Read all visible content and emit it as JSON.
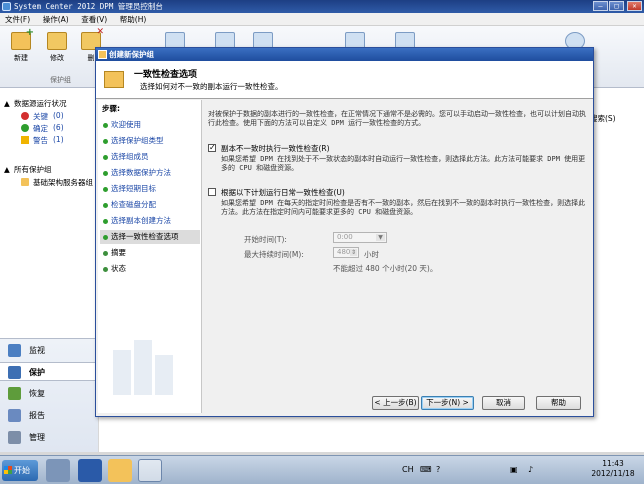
{
  "window": {
    "title": "System Center 2012 DPM 管理员控制台"
  },
  "menu": [
    "文件(F)",
    "操作(A)",
    "查看(V)",
    "帮助(H)"
  ],
  "ribbon": {
    "buttons": [
      {
        "label": "新建",
        "icon": "new-protection-group-icon"
      },
      {
        "label": "修改",
        "icon": "modify-icon"
      },
      {
        "label": "删",
        "icon": "delete-icon"
      }
    ],
    "group_label": "保护组"
  },
  "left_pane": {
    "status_header": "数据源运行状况",
    "status_items": [
      {
        "label": "关键",
        "count": "(0)",
        "color": "#d32f2f"
      },
      {
        "label": "确定",
        "count": "(6)",
        "color": "#2e9e2e"
      },
      {
        "label": "警告",
        "count": "(1)",
        "color": "#f0b400"
      }
    ],
    "groups_header": "所有保护组",
    "group_item": "基础架构服务器组"
  },
  "nav_bottom": [
    {
      "label": "监视",
      "icon": "monitor-icon"
    },
    {
      "label": "保护",
      "icon": "protection-icon",
      "selected": true
    },
    {
      "label": "恢复",
      "icon": "recovery-icon"
    },
    {
      "label": "报告",
      "icon": "report-icon"
    },
    {
      "label": "管理",
      "icon": "management-icon"
    }
  ],
  "right_pane": {
    "search_hint": "搜索(S)"
  },
  "dialog": {
    "title": "创建新保护组",
    "header_title": "一致性检查选项",
    "header_subtitle": "选择如何对不一致的副本运行一致性检查。",
    "steps_header": "步骤:",
    "steps": [
      "欢迎使用",
      "选择保护组类型",
      "选择组成员",
      "选择数据保护方法",
      "选择短期目标",
      "检查磁盘分配",
      "选择副本创建方法",
      "选择一致性检查选项",
      "摘要",
      "状态"
    ],
    "intro": "对被保护于数据的副本进行的一致性检查，在正常情况下通常不是必需的。您可以手动启动一致性检查，也可以计划自动执行此检查。使用下面的方法可以自定义 DPM 运行一致性检查的方式。",
    "option1": {
      "label": "副本不一致时执行一致性检查(R)",
      "checked": true,
      "desc": "如果您希望 DPM 在找到处于不一致状态的副本时自动运行一致性检查，则选择此方法。此方法可能要求 DPM 使用更多的 CPU 和磁盘资源。"
    },
    "option2": {
      "label": "根据以下计划运行日常一致性检查(U)",
      "checked": false,
      "desc": "如果您希望 DPM 在每天的指定时间检查是否有不一致的副本，然后在找到不一致的副本时执行一致性检查，则选择此方法。此方法在指定时间内可能要求更多的 CPU 和磁盘资源。"
    },
    "start_time_label": "开始时间(T):",
    "start_time_value": "0:00",
    "max_duration_label": "最大持续时间(M):",
    "max_duration_value": "480",
    "max_duration_unit": "小时",
    "limit_note": "不能超过 480 个小时(20 天)。",
    "buttons": {
      "back": "< 上一步(B)",
      "next": "下一步(N) >",
      "cancel": "取消",
      "help": "帮助"
    }
  },
  "taskbar": {
    "start_label": "开始",
    "tray_lang": "CH",
    "clock_time": "11:43",
    "clock_date": "2012/11/18"
  }
}
